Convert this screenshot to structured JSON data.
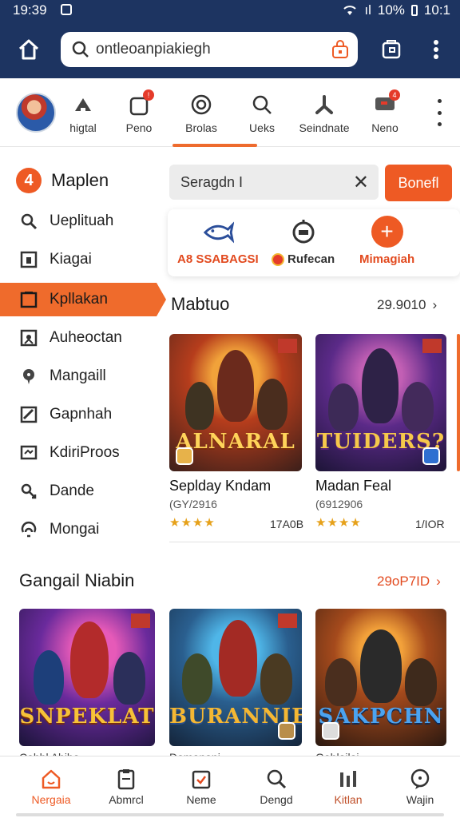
{
  "status_bar": {
    "time": "19:39",
    "battery": "10%",
    "clock_right": "10:1",
    "signal": "ıl"
  },
  "search": {
    "value": "ontleoanpiakiegh"
  },
  "categories": [
    {
      "label": "higtal",
      "icon": "trophy-icon"
    },
    {
      "label": "Peno",
      "icon": "bag-icon"
    },
    {
      "label": "Brolas",
      "icon": "target-icon"
    },
    {
      "label": "Ueks",
      "icon": "search-icon"
    },
    {
      "label": "Seindnate",
      "icon": "person-icon"
    },
    {
      "label": "Neno",
      "icon": "message-icon"
    }
  ],
  "sidebar": {
    "title": "Maplen",
    "items": [
      {
        "label": "Ueplituah",
        "icon": "search-icon"
      },
      {
        "label": "Kiagai",
        "icon": "window-icon"
      },
      {
        "label": "Kpllakan",
        "icon": "checklist-icon",
        "active": true
      },
      {
        "label": "Auheoctan",
        "icon": "shield-icon"
      },
      {
        "label": "Mangaill",
        "icon": "pin-icon"
      },
      {
        "label": "Gapnhah",
        "icon": "checkbox-icon"
      },
      {
        "label": "KdiriProos",
        "icon": "monitor-icon"
      },
      {
        "label": "Dande",
        "icon": "link-icon"
      },
      {
        "label": "Mongai",
        "icon": "swirl-icon"
      }
    ]
  },
  "filter": {
    "value": "Seragdn I",
    "button_label": "Bonefl"
  },
  "quick_actions": [
    {
      "label": "A8 SSABAGSI",
      "color": "#e24a1f"
    },
    {
      "label": "Rufecan",
      "color": "#333333"
    },
    {
      "label": "Mimagiah",
      "color": "#e24a1f"
    }
  ],
  "section1": {
    "title": "Mabtuo",
    "link": "29.9010",
    "chevron": "›"
  },
  "section1_games": [
    {
      "title": "Seplday Kndam",
      "meta": "(GY/2916",
      "rating": "★★★★",
      "size": "17A0B",
      "art_text": "ALNARAL"
    },
    {
      "title": "Madan Feal",
      "meta": "(6912906",
      "rating": "★★★★",
      "size": "1/IOR",
      "art_text": "TUIDERS?"
    }
  ],
  "section2": {
    "title": "Gangail Niabin",
    "link": "29oP7ID",
    "chevron": "›"
  },
  "section2_games": [
    {
      "art_text": "SNPEKLAT",
      "clip": "Cahhl Ahiha"
    },
    {
      "art_text": "BURANNIE",
      "clip": "Damanani"
    },
    {
      "art_text": "SAKPCHN",
      "clip": "Gahlailai"
    }
  ],
  "bottom_nav": [
    {
      "label": "Nergaia",
      "icon": "home-icon",
      "active": true
    },
    {
      "label": "Abmrcl",
      "icon": "clipboard-icon"
    },
    {
      "label": "Neme",
      "icon": "calendar-icon"
    },
    {
      "label": "Dengd",
      "icon": "search-icon"
    },
    {
      "label": "Kitlan",
      "icon": "bars-icon"
    },
    {
      "label": "Wajin",
      "icon": "chat-icon"
    }
  ],
  "colors": {
    "accent": "#ee5a24",
    "header": "#1d3461"
  }
}
